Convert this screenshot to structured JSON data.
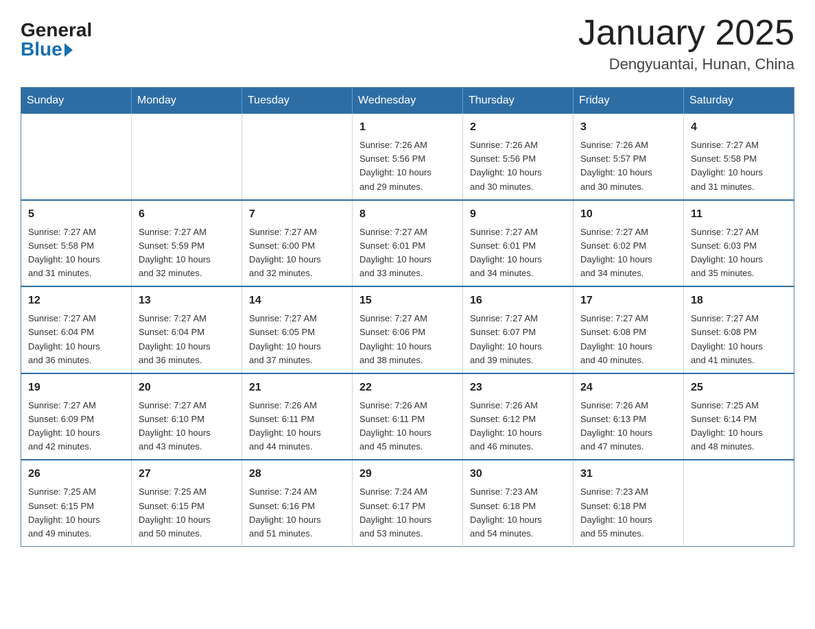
{
  "header": {
    "logo_general": "General",
    "logo_blue": "Blue",
    "month_title": "January 2025",
    "location": "Dengyuantai, Hunan, China"
  },
  "days_of_week": [
    "Sunday",
    "Monday",
    "Tuesday",
    "Wednesday",
    "Thursday",
    "Friday",
    "Saturday"
  ],
  "weeks": [
    [
      {
        "day": "",
        "info": ""
      },
      {
        "day": "",
        "info": ""
      },
      {
        "day": "",
        "info": ""
      },
      {
        "day": "1",
        "info": "Sunrise: 7:26 AM\nSunset: 5:56 PM\nDaylight: 10 hours\nand 29 minutes."
      },
      {
        "day": "2",
        "info": "Sunrise: 7:26 AM\nSunset: 5:56 PM\nDaylight: 10 hours\nand 30 minutes."
      },
      {
        "day": "3",
        "info": "Sunrise: 7:26 AM\nSunset: 5:57 PM\nDaylight: 10 hours\nand 30 minutes."
      },
      {
        "day": "4",
        "info": "Sunrise: 7:27 AM\nSunset: 5:58 PM\nDaylight: 10 hours\nand 31 minutes."
      }
    ],
    [
      {
        "day": "5",
        "info": "Sunrise: 7:27 AM\nSunset: 5:58 PM\nDaylight: 10 hours\nand 31 minutes."
      },
      {
        "day": "6",
        "info": "Sunrise: 7:27 AM\nSunset: 5:59 PM\nDaylight: 10 hours\nand 32 minutes."
      },
      {
        "day": "7",
        "info": "Sunrise: 7:27 AM\nSunset: 6:00 PM\nDaylight: 10 hours\nand 32 minutes."
      },
      {
        "day": "8",
        "info": "Sunrise: 7:27 AM\nSunset: 6:01 PM\nDaylight: 10 hours\nand 33 minutes."
      },
      {
        "day": "9",
        "info": "Sunrise: 7:27 AM\nSunset: 6:01 PM\nDaylight: 10 hours\nand 34 minutes."
      },
      {
        "day": "10",
        "info": "Sunrise: 7:27 AM\nSunset: 6:02 PM\nDaylight: 10 hours\nand 34 minutes."
      },
      {
        "day": "11",
        "info": "Sunrise: 7:27 AM\nSunset: 6:03 PM\nDaylight: 10 hours\nand 35 minutes."
      }
    ],
    [
      {
        "day": "12",
        "info": "Sunrise: 7:27 AM\nSunset: 6:04 PM\nDaylight: 10 hours\nand 36 minutes."
      },
      {
        "day": "13",
        "info": "Sunrise: 7:27 AM\nSunset: 6:04 PM\nDaylight: 10 hours\nand 36 minutes."
      },
      {
        "day": "14",
        "info": "Sunrise: 7:27 AM\nSunset: 6:05 PM\nDaylight: 10 hours\nand 37 minutes."
      },
      {
        "day": "15",
        "info": "Sunrise: 7:27 AM\nSunset: 6:06 PM\nDaylight: 10 hours\nand 38 minutes."
      },
      {
        "day": "16",
        "info": "Sunrise: 7:27 AM\nSunset: 6:07 PM\nDaylight: 10 hours\nand 39 minutes."
      },
      {
        "day": "17",
        "info": "Sunrise: 7:27 AM\nSunset: 6:08 PM\nDaylight: 10 hours\nand 40 minutes."
      },
      {
        "day": "18",
        "info": "Sunrise: 7:27 AM\nSunset: 6:08 PM\nDaylight: 10 hours\nand 41 minutes."
      }
    ],
    [
      {
        "day": "19",
        "info": "Sunrise: 7:27 AM\nSunset: 6:09 PM\nDaylight: 10 hours\nand 42 minutes."
      },
      {
        "day": "20",
        "info": "Sunrise: 7:27 AM\nSunset: 6:10 PM\nDaylight: 10 hours\nand 43 minutes."
      },
      {
        "day": "21",
        "info": "Sunrise: 7:26 AM\nSunset: 6:11 PM\nDaylight: 10 hours\nand 44 minutes."
      },
      {
        "day": "22",
        "info": "Sunrise: 7:26 AM\nSunset: 6:11 PM\nDaylight: 10 hours\nand 45 minutes."
      },
      {
        "day": "23",
        "info": "Sunrise: 7:26 AM\nSunset: 6:12 PM\nDaylight: 10 hours\nand 46 minutes."
      },
      {
        "day": "24",
        "info": "Sunrise: 7:26 AM\nSunset: 6:13 PM\nDaylight: 10 hours\nand 47 minutes."
      },
      {
        "day": "25",
        "info": "Sunrise: 7:25 AM\nSunset: 6:14 PM\nDaylight: 10 hours\nand 48 minutes."
      }
    ],
    [
      {
        "day": "26",
        "info": "Sunrise: 7:25 AM\nSunset: 6:15 PM\nDaylight: 10 hours\nand 49 minutes."
      },
      {
        "day": "27",
        "info": "Sunrise: 7:25 AM\nSunset: 6:15 PM\nDaylight: 10 hours\nand 50 minutes."
      },
      {
        "day": "28",
        "info": "Sunrise: 7:24 AM\nSunset: 6:16 PM\nDaylight: 10 hours\nand 51 minutes."
      },
      {
        "day": "29",
        "info": "Sunrise: 7:24 AM\nSunset: 6:17 PM\nDaylight: 10 hours\nand 53 minutes."
      },
      {
        "day": "30",
        "info": "Sunrise: 7:23 AM\nSunset: 6:18 PM\nDaylight: 10 hours\nand 54 minutes."
      },
      {
        "day": "31",
        "info": "Sunrise: 7:23 AM\nSunset: 6:18 PM\nDaylight: 10 hours\nand 55 minutes."
      },
      {
        "day": "",
        "info": ""
      }
    ]
  ]
}
